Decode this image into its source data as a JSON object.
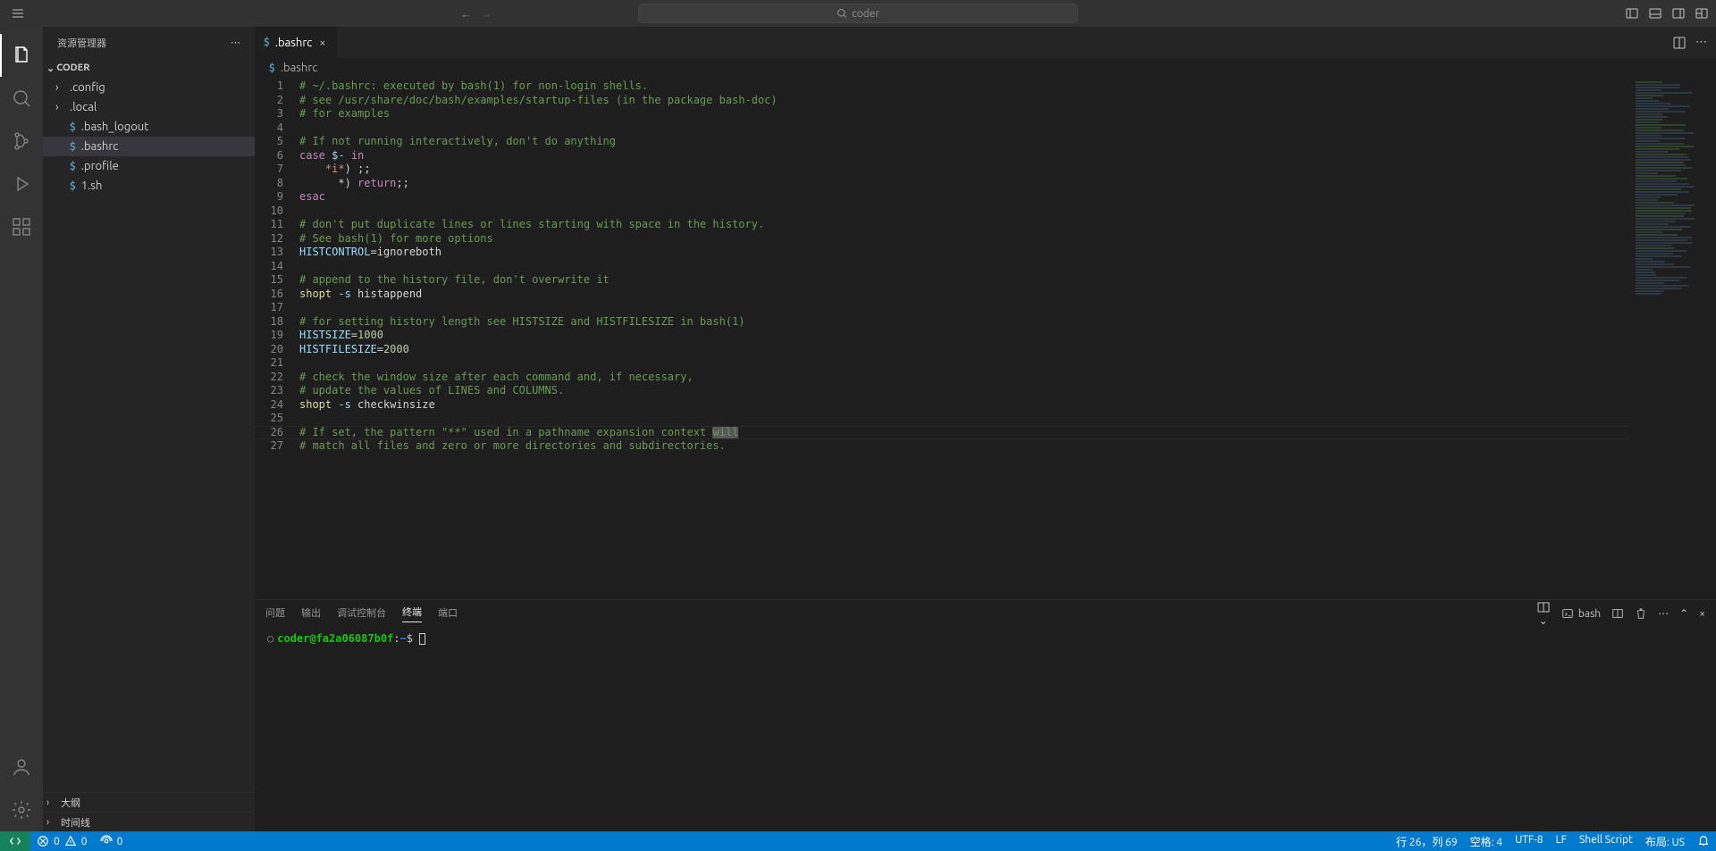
{
  "titlebar": {
    "search_text": "coder"
  },
  "sidebar": {
    "title": "资源管理器",
    "root": "CODER",
    "tree": [
      {
        "type": "folder",
        "name": ".config"
      },
      {
        "type": "folder",
        "name": ".local"
      },
      {
        "type": "file",
        "name": ".bash_logout"
      },
      {
        "type": "file",
        "name": ".bashrc",
        "selected": true
      },
      {
        "type": "file",
        "name": ".profile"
      },
      {
        "type": "file",
        "name": "1.sh"
      }
    ],
    "outline": "大纲",
    "timeline": "时间线"
  },
  "tabs": {
    "active": ".bashrc"
  },
  "breadcrumb": ".bashrc",
  "code": {
    "lines": [
      {
        "n": 1,
        "seg": [
          [
            "c",
            "# ~/.bashrc: executed by bash(1) for non-login shells."
          ]
        ]
      },
      {
        "n": 2,
        "seg": [
          [
            "c",
            "# see /usr/share/doc/bash/examples/startup-files (in the package bash-doc)"
          ]
        ]
      },
      {
        "n": 3,
        "seg": [
          [
            "c",
            "# for examples"
          ]
        ]
      },
      {
        "n": 4,
        "seg": []
      },
      {
        "n": 5,
        "seg": [
          [
            "c",
            "# If not running interactively, don't do anything"
          ]
        ]
      },
      {
        "n": 6,
        "seg": [
          [
            "k",
            "case"
          ],
          [
            "p",
            " "
          ],
          [
            "v",
            "$-"
          ],
          [
            "p",
            " "
          ],
          [
            "k",
            "in"
          ]
        ]
      },
      {
        "n": 7,
        "seg": [
          [
            "p",
            "    "
          ],
          [
            "s",
            "*i*"
          ],
          [
            "p",
            ") ;;"
          ]
        ]
      },
      {
        "n": 8,
        "seg": [
          [
            "p",
            "      *) "
          ],
          [
            "k",
            "return"
          ],
          [
            "p",
            ";;"
          ]
        ]
      },
      {
        "n": 9,
        "seg": [
          [
            "k",
            "esac"
          ]
        ]
      },
      {
        "n": 10,
        "seg": []
      },
      {
        "n": 11,
        "seg": [
          [
            "c",
            "# don't put duplicate lines or lines starting with space in the history."
          ]
        ]
      },
      {
        "n": 12,
        "seg": [
          [
            "c",
            "# See bash(1) for more options"
          ]
        ]
      },
      {
        "n": 13,
        "seg": [
          [
            "v",
            "HISTCONTROL"
          ],
          [
            "p",
            "=ignoreboth"
          ]
        ]
      },
      {
        "n": 14,
        "seg": []
      },
      {
        "n": 15,
        "seg": [
          [
            "c",
            "# append to the history file, don't overwrite it"
          ]
        ]
      },
      {
        "n": 16,
        "seg": [
          [
            "b",
            "shopt"
          ],
          [
            "p",
            " "
          ],
          [
            "v",
            "-s"
          ],
          [
            "p",
            " histappend"
          ]
        ]
      },
      {
        "n": 17,
        "seg": []
      },
      {
        "n": 18,
        "seg": [
          [
            "c",
            "# for setting history length see HISTSIZE and HISTFILESIZE in bash(1)"
          ]
        ]
      },
      {
        "n": 19,
        "seg": [
          [
            "v",
            "HISTSIZE"
          ],
          [
            "p",
            "="
          ],
          [
            "n",
            "1000"
          ]
        ]
      },
      {
        "n": 20,
        "seg": [
          [
            "v",
            "HISTFILESIZE"
          ],
          [
            "p",
            "="
          ],
          [
            "n",
            "2000"
          ]
        ]
      },
      {
        "n": 21,
        "seg": []
      },
      {
        "n": 22,
        "seg": [
          [
            "c",
            "# check the window size after each command and, if necessary,"
          ]
        ]
      },
      {
        "n": 23,
        "seg": [
          [
            "c",
            "# update the values of LINES and COLUMNS."
          ]
        ]
      },
      {
        "n": 24,
        "seg": [
          [
            "b",
            "shopt"
          ],
          [
            "p",
            " "
          ],
          [
            "v",
            "-s"
          ],
          [
            "p",
            " checkwinsize"
          ]
        ]
      },
      {
        "n": 25,
        "seg": []
      },
      {
        "n": 26,
        "seg": [
          [
            "c",
            "# If set, the pattern \"**\" used in a pathname expansion context "
          ],
          [
            "hl",
            "will"
          ]
        ]
      },
      {
        "n": 27,
        "seg": [
          [
            "c",
            "# match all files and zero or more directories and subdirectories."
          ]
        ]
      }
    ],
    "current_line_index": 25
  },
  "panel": {
    "tabs": [
      "问题",
      "输出",
      "调试控制台",
      "终端",
      "端口"
    ],
    "active": "终端",
    "terminal_label": "bash",
    "prompt_user": "coder@fa2a06087b0f",
    "prompt_path": "~"
  },
  "status": {
    "errors": "0",
    "warnings": "0",
    "ports": "0",
    "ln_col": "行 26，列 69",
    "spaces": "空格: 4",
    "encoding": "UTF-8",
    "eol": "LF",
    "lang": "Shell Script",
    "layout": "布局: US"
  }
}
